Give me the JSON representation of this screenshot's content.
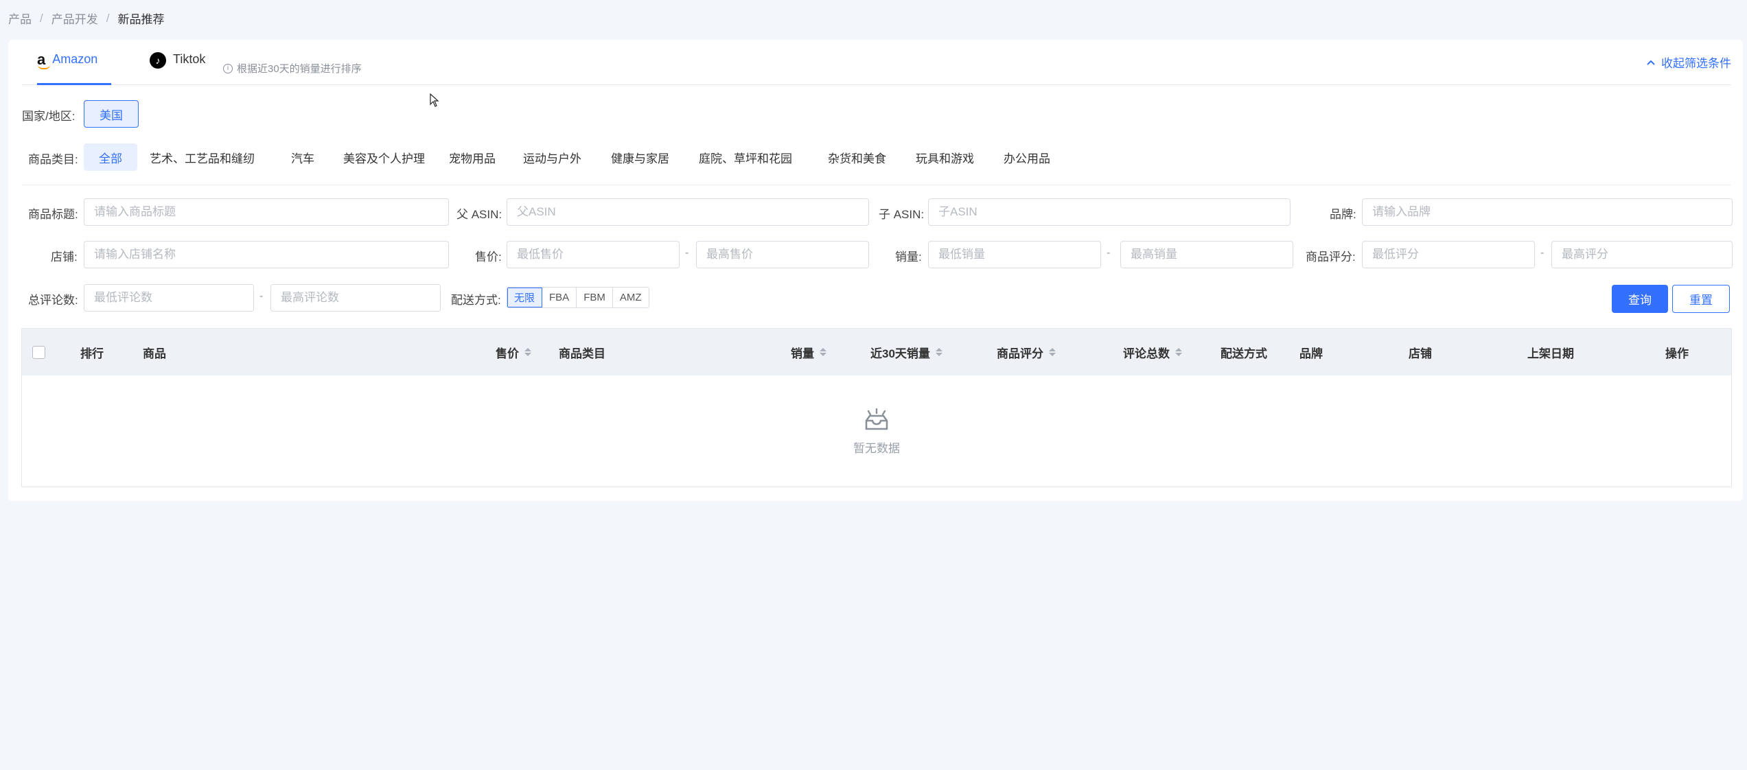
{
  "breadcrumb": [
    "产品",
    "产品开发",
    "新品推荐"
  ],
  "tabs": [
    {
      "label": "Amazon",
      "icon": "amazon-icon",
      "active": true
    },
    {
      "label": "Tiktok",
      "icon": "tiktok-icon",
      "active": false
    }
  ],
  "tab_hint": "根据近30天的销量进行排序",
  "collapse_label": "收起筛选条件",
  "region": {
    "label": "国家/地区:",
    "value": "美国"
  },
  "categories": {
    "label": "商品类目:",
    "items": [
      "全部",
      "艺术、工艺品和缝纫",
      "汽车",
      "美容及个人护理",
      "宠物用品",
      "运动与户外",
      "健康与家居",
      "庭院、草坪和花园",
      "杂货和美食",
      "玩具和游戏",
      "办公用品"
    ],
    "active": "全部"
  },
  "filters": {
    "title": {
      "label": "商品标题:",
      "placeholder": "请输入商品标题"
    },
    "parent_asin": {
      "label": "父 ASIN:",
      "placeholder": "父ASIN"
    },
    "child_asin": {
      "label": "子 ASIN:",
      "placeholder": "子ASIN"
    },
    "brand": {
      "label": "品牌:",
      "placeholder": "请输入品牌"
    },
    "store": {
      "label": "店铺:",
      "placeholder": "请输入店铺名称"
    },
    "price": {
      "label": "售价:",
      "min": "最低售价",
      "max": "最高售价"
    },
    "sales": {
      "label": "销量:",
      "min": "最低销量",
      "max": "最高销量"
    },
    "rating": {
      "label": "商品评分:",
      "min": "最低评分",
      "max": "最高评分"
    },
    "reviews": {
      "label": "总评论数:",
      "min": "最低评论数",
      "max": "最高评论数"
    },
    "delivery": {
      "label": "配送方式:",
      "options": [
        "无限",
        "FBA",
        "FBM",
        "AMZ"
      ],
      "selected": "无限"
    },
    "separator": "-"
  },
  "buttons": {
    "query": "查询",
    "reset": "重置"
  },
  "table": {
    "columns": [
      "排行",
      "商品",
      "售价",
      "商品类目",
      "销量",
      "近30天销量",
      "商品评分",
      "评论总数",
      "配送方式",
      "品牌",
      "店铺",
      "上架日期",
      "操作"
    ],
    "empty_text": "暂无数据"
  },
  "colors": {
    "accent": "#3370ff",
    "background": "#f3f6fb",
    "header_bg": "#eef1f6"
  }
}
